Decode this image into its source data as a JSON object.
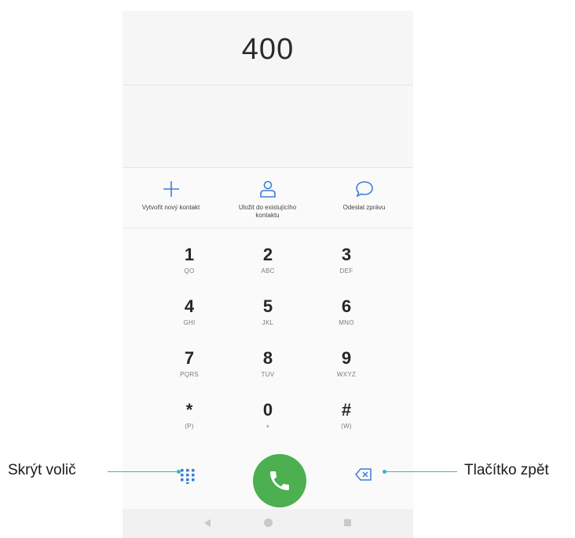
{
  "dialer": {
    "number": "400",
    "actions": [
      {
        "label": "Vytvořit nový kontakt",
        "icon": "plus-icon"
      },
      {
        "label": "Uložit do existujícího kontaktu",
        "icon": "person-icon"
      },
      {
        "label": "Odeslat zprávu",
        "icon": "chat-bubble-icon"
      }
    ],
    "keys": [
      {
        "digit": "1",
        "letters": "QO"
      },
      {
        "digit": "2",
        "letters": "ABC"
      },
      {
        "digit": "3",
        "letters": "DEF"
      },
      {
        "digit": "4",
        "letters": "GHI"
      },
      {
        "digit": "5",
        "letters": "JKL"
      },
      {
        "digit": "6",
        "letters": "MNO"
      },
      {
        "digit": "7",
        "letters": "PQRS"
      },
      {
        "digit": "8",
        "letters": "TUV"
      },
      {
        "digit": "9",
        "letters": "WXYZ"
      },
      {
        "digit": "*",
        "letters": "(P)"
      },
      {
        "digit": "0",
        "letters": "+"
      },
      {
        "digit": "#",
        "letters": "(W)"
      }
    ],
    "accent_color": "#3b7dd8",
    "call_color": "#4caf50"
  },
  "callouts": {
    "left": "Skrýt volič",
    "right": "Tlačítko zpět"
  }
}
